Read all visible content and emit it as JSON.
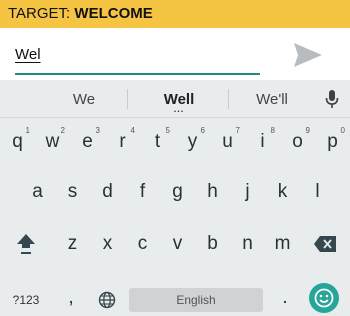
{
  "target": {
    "label": "TARGET: ",
    "value": "WELCOME"
  },
  "input": {
    "value": "Wel"
  },
  "icons": {
    "send": "send-arrow-icon",
    "mic": "microphone-icon",
    "shift": "shift-arrow-icon",
    "backspace": "backspace-icon",
    "language": "globe-icon",
    "emoji": "smiley-icon"
  },
  "suggestions": {
    "left": "We",
    "center": "Well",
    "right": "We'll",
    "center_more": "..."
  },
  "keys": {
    "row1": [
      "q",
      "w",
      "e",
      "r",
      "t",
      "y",
      "u",
      "i",
      "o",
      "p"
    ],
    "row1_hints": [
      "1",
      "2",
      "3",
      "4",
      "5",
      "6",
      "7",
      "8",
      "9",
      "0"
    ],
    "row2": [
      "a",
      "s",
      "d",
      "f",
      "g",
      "h",
      "j",
      "k",
      "l"
    ],
    "row3": [
      "z",
      "x",
      "c",
      "v",
      "b",
      "n",
      "m"
    ],
    "symbols": "?123",
    "comma": ",",
    "space": "English",
    "period": "."
  },
  "colors": {
    "target_bg": "#f5c443",
    "accent": "#1f8b83",
    "emoji_bg": "#26a69a",
    "keyboard_bg": "#e9eced"
  }
}
